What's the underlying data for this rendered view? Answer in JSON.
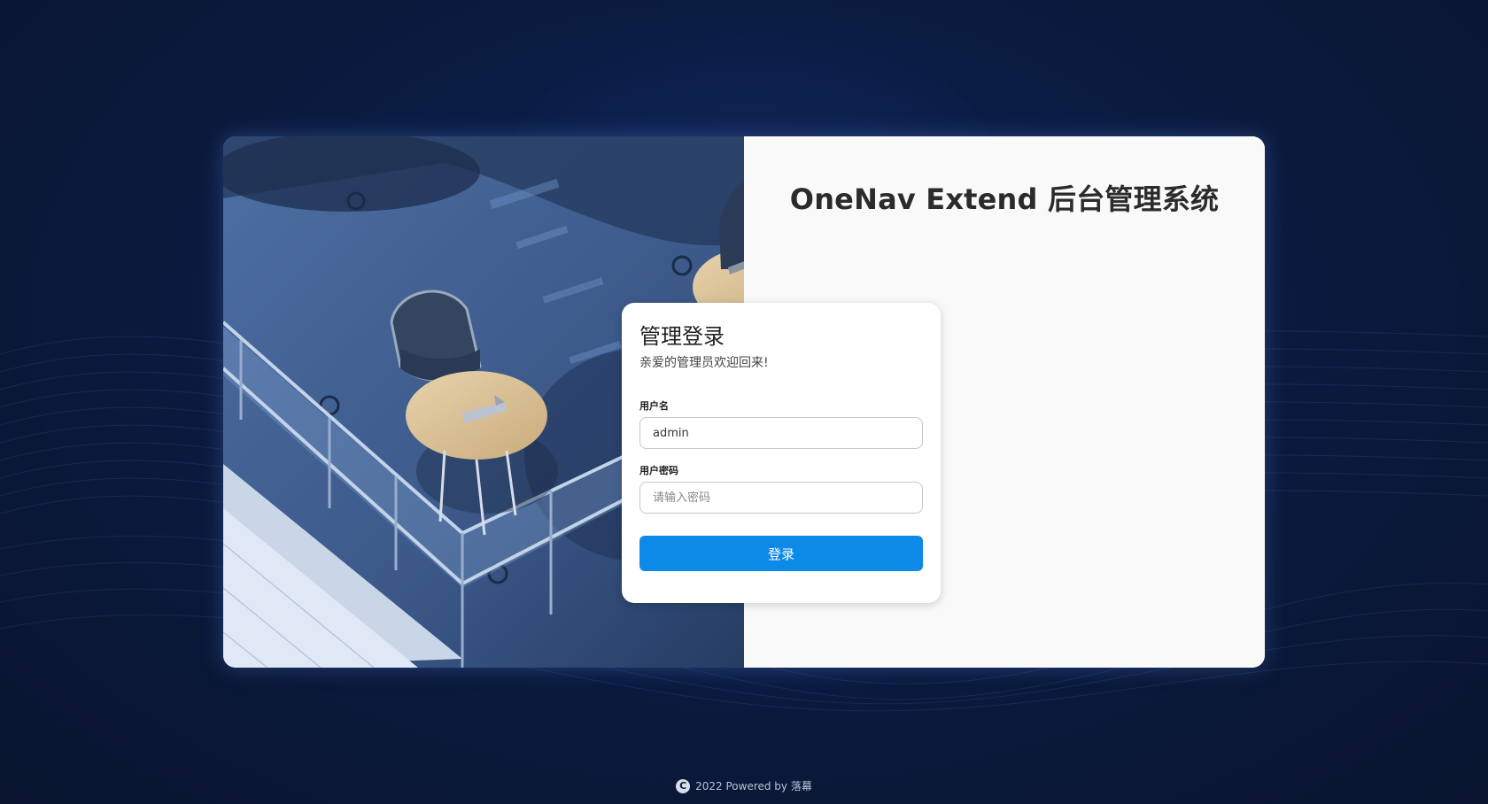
{
  "app": {
    "title": "OneNav Extend 后台管理系统"
  },
  "login": {
    "heading": "管理登录",
    "subtitle": "亲爱的管理员欢迎回来!",
    "username_label": "用户名",
    "username_value": "admin",
    "password_label": "用户密码",
    "password_placeholder": "请输入密码",
    "submit_label": "登录"
  },
  "footer": {
    "icon": "copyright-icon",
    "text": "2022 Powered by 落幕"
  },
  "colors": {
    "background": "#0a1838",
    "accent": "#0d8ae8",
    "panel": "#f9f9f9"
  }
}
